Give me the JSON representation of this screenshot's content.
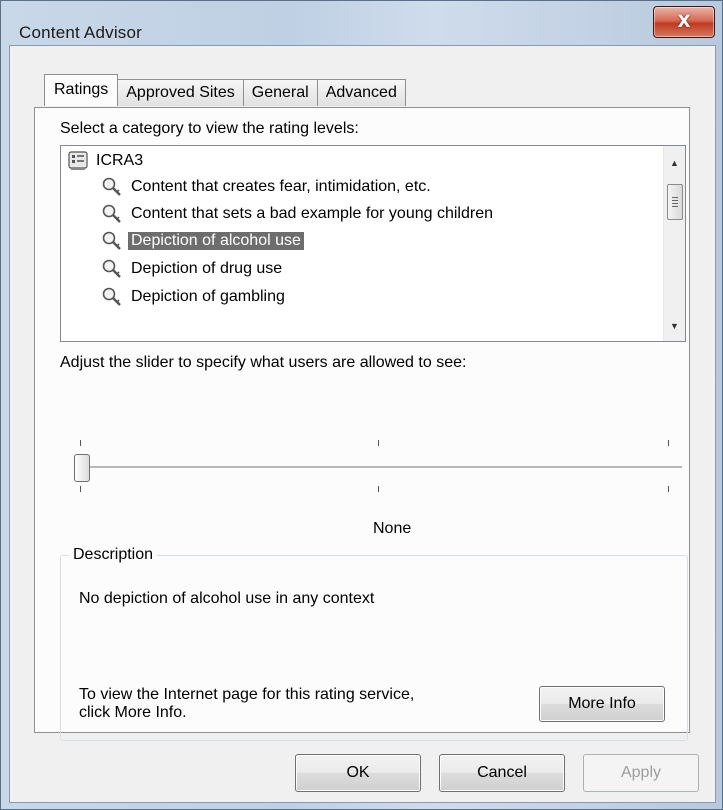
{
  "window": {
    "title": "Content Advisor",
    "close_glyph": "X"
  },
  "tabs": [
    {
      "label": "Ratings",
      "active": true
    },
    {
      "label": "Approved Sites",
      "active": false
    },
    {
      "label": "General",
      "active": false
    },
    {
      "label": "Advanced",
      "active": false
    }
  ],
  "ratings": {
    "category_prompt": "Select a category to view the rating levels:",
    "tree": {
      "root": "ICRA3",
      "items": [
        "Content that creates fear, intimidation, etc.",
        "Content that sets a bad example for young children",
        "Depiction of alcohol use",
        "Depiction of drug use",
        "Depiction of gambling"
      ],
      "selected_index": 2
    },
    "slider_prompt": "Adjust the slider to specify what users are allowed to see:",
    "slider_level_label": "None",
    "description": {
      "legend": "Description",
      "text": "No depiction of alcohol use in any context",
      "info_text_line1": "To view the Internet page for this rating service,",
      "info_text_line2": "click More Info.",
      "more_info_label": "More Info"
    }
  },
  "buttons": {
    "ok": "OK",
    "cancel": "Cancel",
    "apply": "Apply"
  }
}
